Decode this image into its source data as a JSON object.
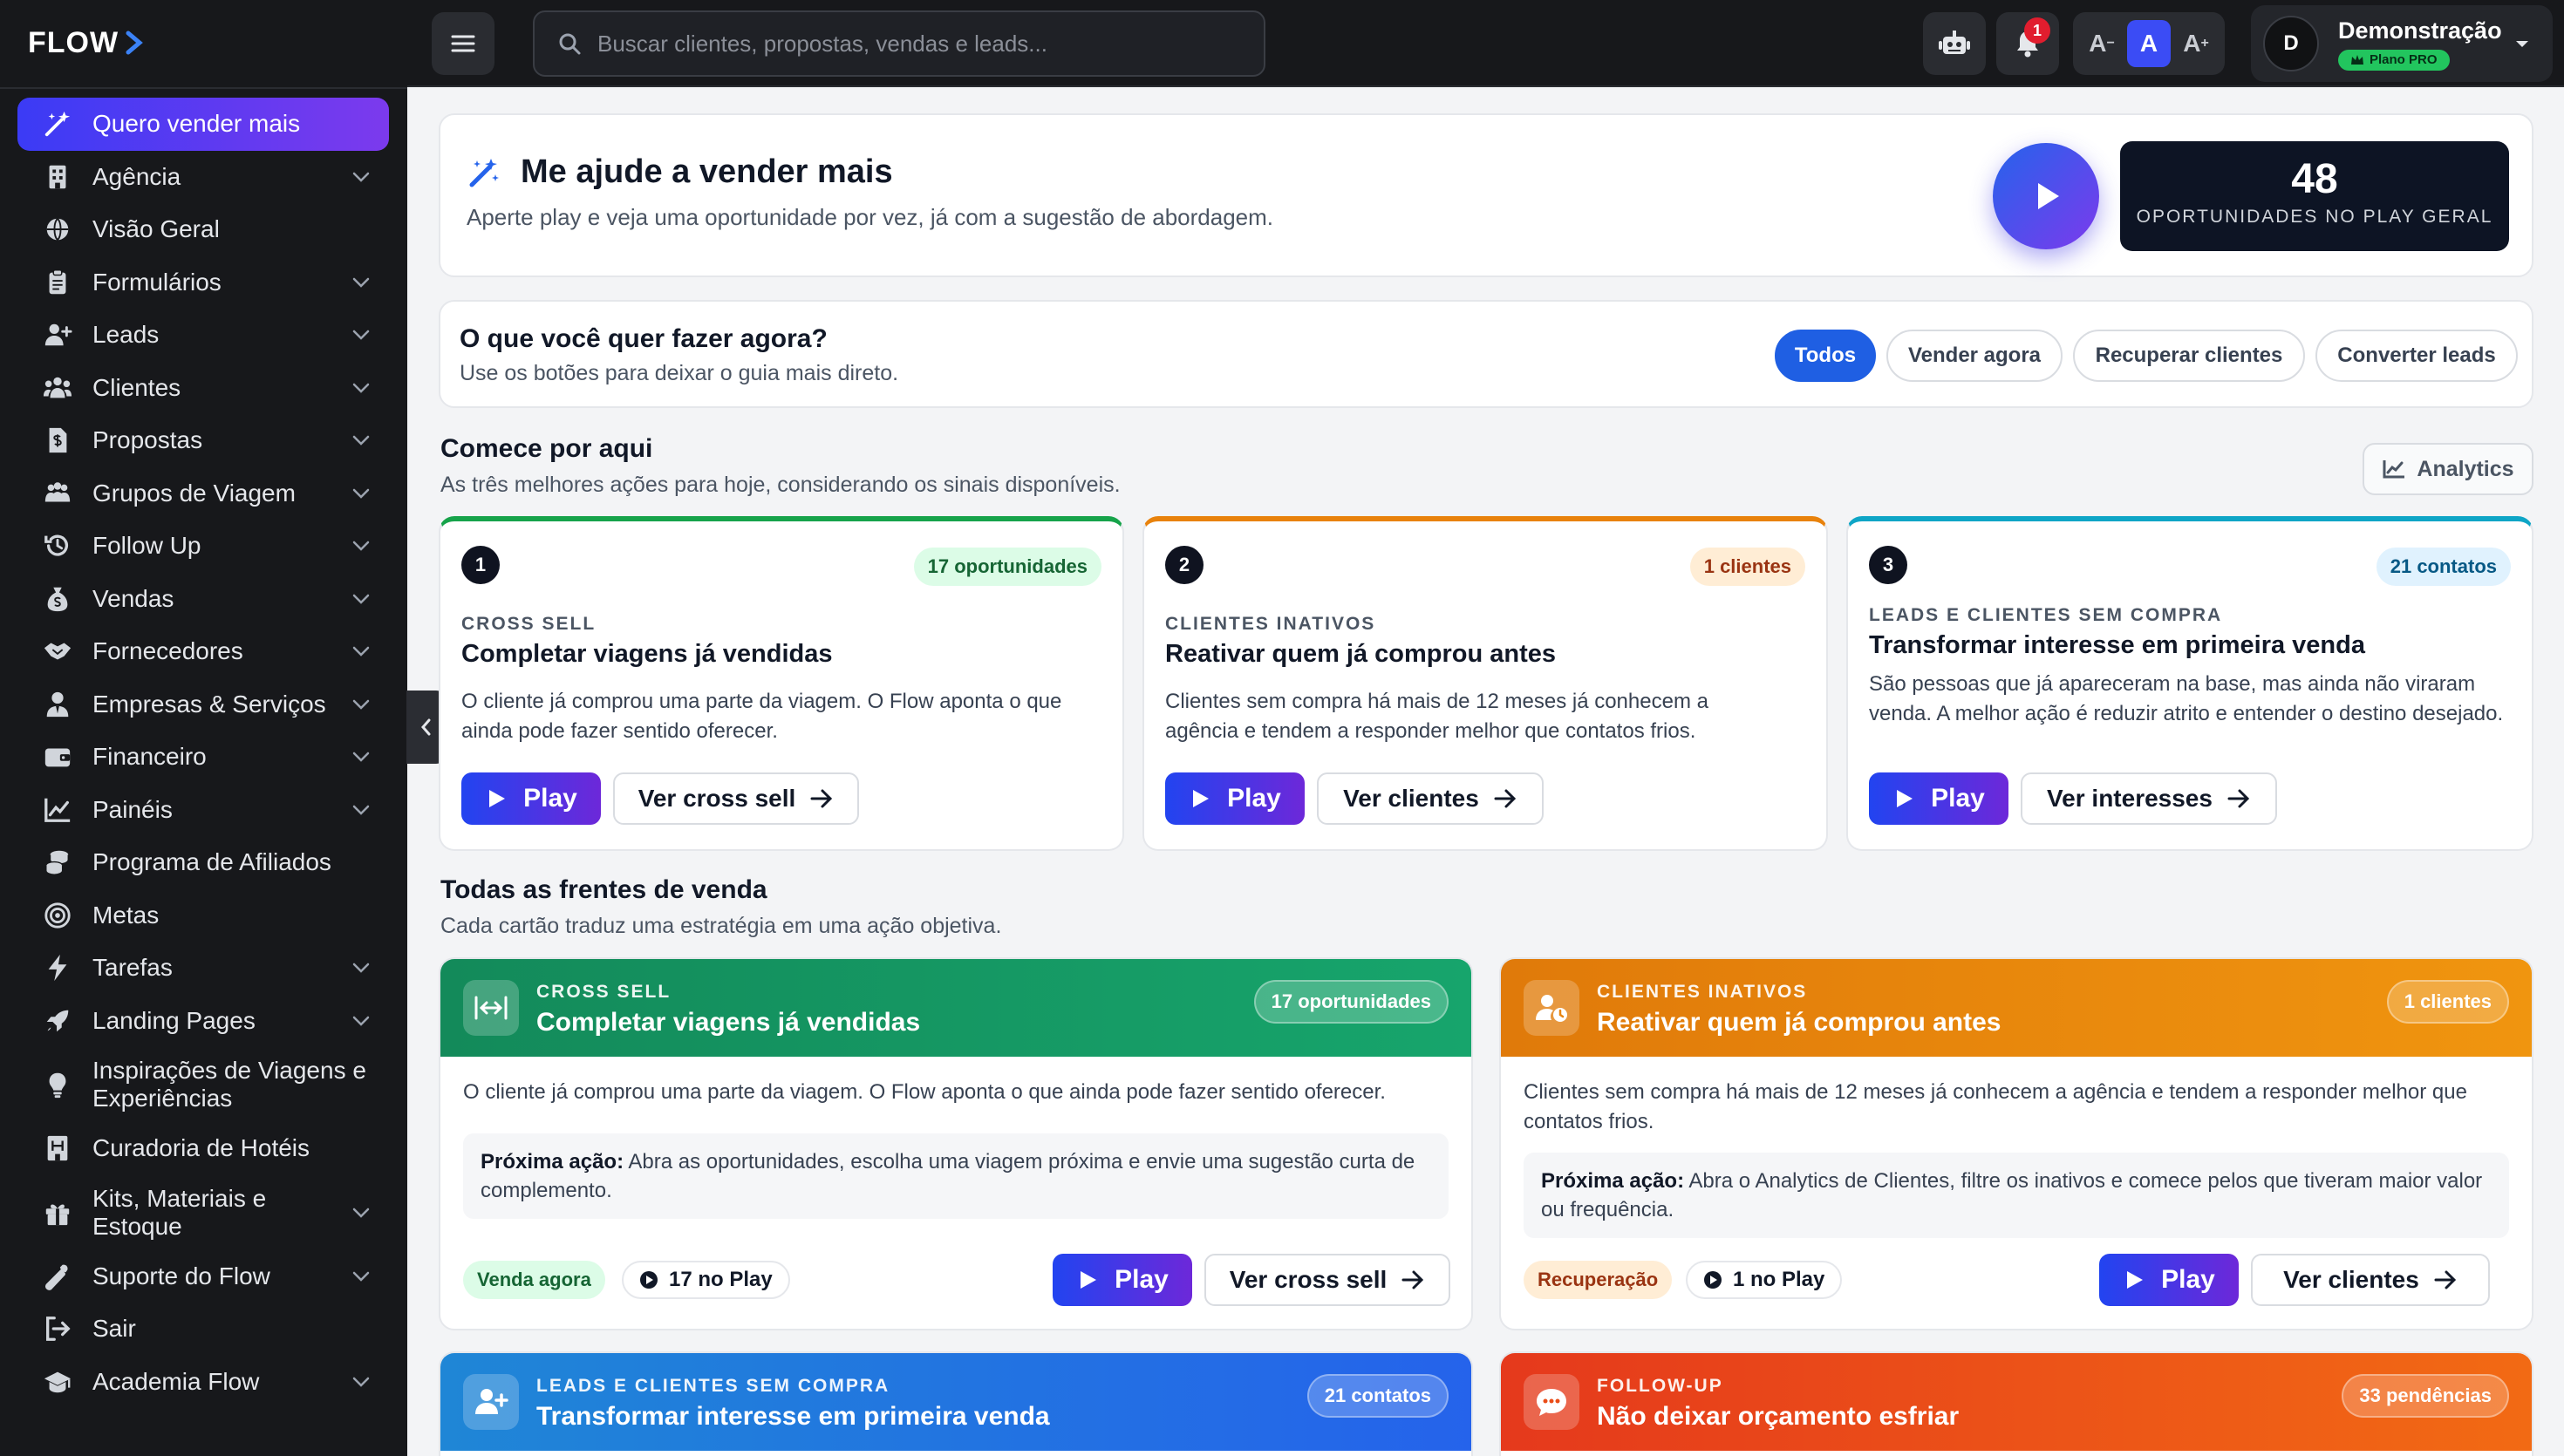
{
  "brand": {
    "logo_text": "FLOW"
  },
  "sidebar": {
    "items": [
      {
        "label": "Quero vender mais",
        "icon": "magic-wand-icon"
      },
      {
        "label": "Agência",
        "icon": "building-icon"
      },
      {
        "label": "Visão Geral",
        "icon": "globe-icon"
      },
      {
        "label": "Formulários",
        "icon": "clipboard-icon"
      },
      {
        "label": "Leads",
        "icon": "user-plus-icon"
      },
      {
        "label": "Clientes",
        "icon": "users-icon"
      },
      {
        "label": "Propostas",
        "icon": "file-dollar-icon"
      },
      {
        "label": "Grupos de Viagem",
        "icon": "people-group-icon"
      },
      {
        "label": "Follow Up",
        "icon": "history-icon"
      },
      {
        "label": "Vendas",
        "icon": "money-bag-icon"
      },
      {
        "label": "Fornecedores",
        "icon": "handshake-icon"
      },
      {
        "label": "Empresas & Serviços",
        "icon": "user-tie-icon"
      },
      {
        "label": "Financeiro",
        "icon": "wallet-icon"
      },
      {
        "label": "Painéis",
        "icon": "line-chart-icon"
      },
      {
        "label": "Programa de Afiliados",
        "icon": "coins-icon"
      },
      {
        "label": "Metas",
        "icon": "target-icon"
      },
      {
        "label": "Tarefas",
        "icon": "bolt-icon"
      },
      {
        "label": "Landing Pages",
        "icon": "rocket-icon"
      },
      {
        "label": "Inspirações de Viagens e Experiências",
        "icon": "lightbulb-icon"
      },
      {
        "label": "Curadoria de Hotéis",
        "icon": "hotel-icon"
      },
      {
        "label": "Kits, Materiais e Estoque",
        "icon": "gift-icon"
      },
      {
        "label": "Suporte do Flow",
        "icon": "wrench-icon"
      },
      {
        "label": "Sair",
        "icon": "logout-icon"
      },
      {
        "label": "Academia Flow",
        "icon": "graduation-cap-icon"
      }
    ]
  },
  "topbar": {
    "search_placeholder": "Buscar clientes, propostas, vendas e leads...",
    "notification_count": "1",
    "font_small": "A",
    "font_normal": "A",
    "font_large": "A",
    "font_small_sign": "−",
    "font_large_sign": "+",
    "user_name": "Demonstração",
    "user_initial": "D",
    "plan_label": "Plano PRO"
  },
  "hero": {
    "title": "Me ajude a vender mais",
    "subtitle": "Aperte play e veja uma oportunidade por vez, já com a sugestão de abordagem.",
    "stat_value": "48",
    "stat_label": "OPORTUNIDADES NO PLAY GERAL"
  },
  "question": {
    "title": "O que você quer fazer agora?",
    "subtitle": "Use os botões para deixar o guia mais direto.",
    "filters": [
      "Todos",
      "Vender agora",
      "Recuperar clientes",
      "Converter leads"
    ],
    "selected_filter": "Todos"
  },
  "start": {
    "title": "Comece por aqui",
    "subtitle": "As três melhores ações para hoje, considerando os sinais disponíveis.",
    "analytics_label": "Analytics",
    "cards": [
      {
        "number": "1",
        "badge": "17 oportunidades",
        "kicker": "CROSS SELL",
        "title": "Completar viagens já vendidas",
        "desc": "O cliente já comprou uma parte da viagem. O Flow aponta o que ainda pode fazer sentido oferecer.",
        "play": "Play",
        "secondary": "Ver cross sell",
        "accent": "#16a34a"
      },
      {
        "number": "2",
        "badge": "1 clientes",
        "kicker": "CLIENTES INATIVOS",
        "title": "Reativar quem já comprou antes",
        "desc": "Clientes sem compra há mais de 12 meses já conhecem a agência e tendem a responder melhor que contatos frios.",
        "play": "Play",
        "secondary": "Ver clientes",
        "accent": "#e8820c"
      },
      {
        "number": "3",
        "badge": "21 contatos",
        "kicker": "LEADS E CLIENTES SEM COMPRA",
        "title": "Transformar interesse em primeira venda",
        "desc": "São pessoas que já apareceram na base, mas ainda não viraram venda. A melhor ação é reduzir atrito e entender o destino desejado.",
        "play": "Play",
        "secondary": "Ver interesses",
        "accent": "#0ea5c6"
      }
    ]
  },
  "fronts": {
    "title": "Todas as frentes de venda",
    "subtitle": "Cada cartão traduz uma estratégia em uma ação objetiva.",
    "next_action_label": "Próxima ação:",
    "cards": [
      {
        "kicker": "CROSS SELL",
        "title": "Completar viagens já vendidas",
        "badge": "17 oportunidades",
        "desc": "O cliente já comprou uma parte da viagem. O Flow aponta o que ainda pode fazer sentido oferecer.",
        "next_action": "Abra as oportunidades, escolha uma viagem próxima e envie uma sugestão curta de complemento.",
        "tag": "Venda agora",
        "play_count": "17 no Play",
        "play": "Play",
        "secondary": "Ver cross sell",
        "colors": [
          "#138a5a",
          "#17a56c"
        ]
      },
      {
        "kicker": "CLIENTES INATIVOS",
        "title": "Reativar quem já comprou antes",
        "badge": "1 clientes",
        "desc": "Clientes sem compra há mais de 12 meses já conhecem a agência e tendem a responder melhor que contatos frios.",
        "next_action": "Abra o Analytics de Clientes, filtre os inativos e comece pelos que tiveram maior valor ou frequência.",
        "tag": "Recuperação",
        "play_count": "1 no Play",
        "play": "Play",
        "secondary": "Ver clientes",
        "colors": [
          "#e07a0a",
          "#f0950f"
        ]
      },
      {
        "kicker": "LEADS E CLIENTES SEM COMPRA",
        "title": "Transformar interesse em primeira venda",
        "badge": "21 contatos",
        "colors": [
          "#1f86d6",
          "#2563eb"
        ]
      },
      {
        "kicker": "FOLLOW-UP",
        "title": "Não deixar orçamento esfriar",
        "badge": "33 pendências",
        "colors": [
          "#e5391c",
          "#f26a14"
        ]
      }
    ]
  }
}
